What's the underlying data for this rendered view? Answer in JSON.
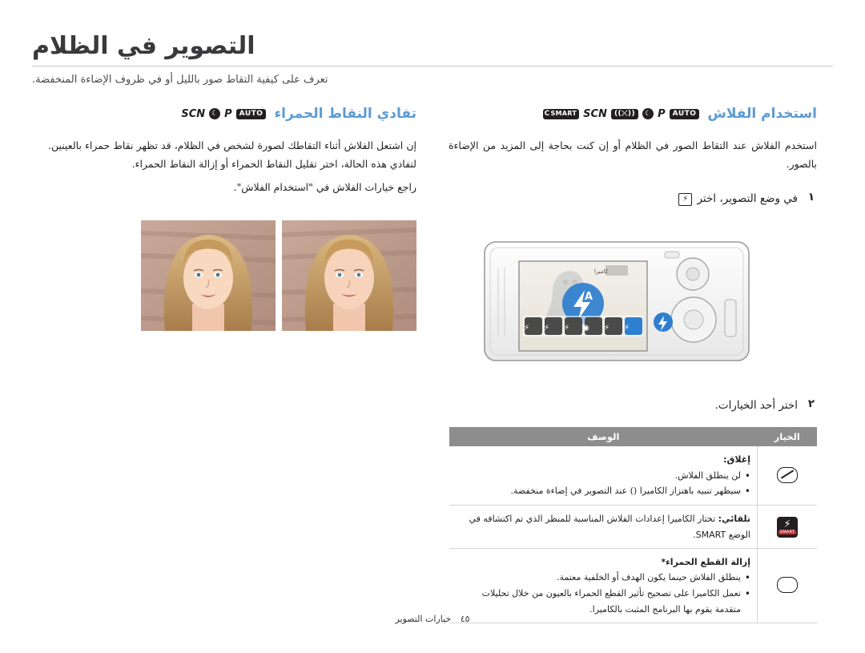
{
  "header": {
    "title": "التصوير في الظلام",
    "subtitle": "تعرف على كيفية التقاط صور بالليل أو في ظروف الإضاءة المنخفضة."
  },
  "right_column": {
    "section_title": "استخدام الفلاش",
    "mode_icons": [
      "SMART",
      "SCN",
      "DUAL-IS",
      "night",
      "P",
      "AUTO"
    ],
    "intro": "استخدم الفلاش عند التقاط الصور في الظلام أو إن كنت بحاجة إلى المزيد من الإضاءة بالصور.",
    "step1": {
      "num": "١",
      "text_before": "في وضع التصوير، اختر",
      "key_icon": "flash-key",
      "text_after": ""
    },
    "step2": {
      "num": "٢",
      "text": "اختر أحد الخيارات."
    },
    "table": {
      "headers": [
        "الخيار",
        "الوصف"
      ],
      "rows": [
        {
          "icon": "flash-off-icon",
          "title": "إغلاق:",
          "bullets": [
            "لن ينطلق الفلاش.",
            "سيظهر تنبيه باهتزاز الكاميرا (\u0001) عند التصوير في إضاءة منخفضة."
          ]
        },
        {
          "icon": "flash-smart-auto-icon",
          "title": "تلقائي:",
          "bullets": [
            "تختار الكاميرا إعدادات الفلاش المناسبة للمنظر الذي تم اكتشافه في الوضع SMART."
          ]
        },
        {
          "icon": "red-eye-icon",
          "title": "إزالة القطع الحمراء*",
          "bullets": [
            "ينطلق الفلاش حينما يكون الهدف أو الخلفية معتمة.",
            "تعمل الكاميرا على تصحيح تأثير القطع الحمراء بالعيون من خلال تحليلات متقدمة يقوم بها البرنامج المثبت بالكاميرا."
          ]
        }
      ]
    }
  },
  "left_column": {
    "section_title": "تفادي النقاط الحمراء",
    "mode_icons": [
      "SCN",
      "night",
      "P",
      "AUTO"
    ],
    "paragraph_1": "إن اشتعل الفلاش أثناء التقاطك لصورة لشخص في الظلام، قد تظهر نقاط حمراء بالعينين. لتفادي هذه الحالة، اختر تقليل النقاط الحمراء أو إزالة النقاط الحمراء.",
    "paragraph_2": "راجع خيارات الفلاش في \"استخدام الفلاش\".",
    "photos": [
      "portrait-normal",
      "portrait-red-eye"
    ]
  },
  "footer": {
    "page_number": "٤٥",
    "label": "خيارات التصوير"
  },
  "colors": {
    "accent": "#5b9bd5",
    "title": "#3a3a3c",
    "table_header": "#8d8d8d",
    "rule": "#c9c9c9"
  }
}
